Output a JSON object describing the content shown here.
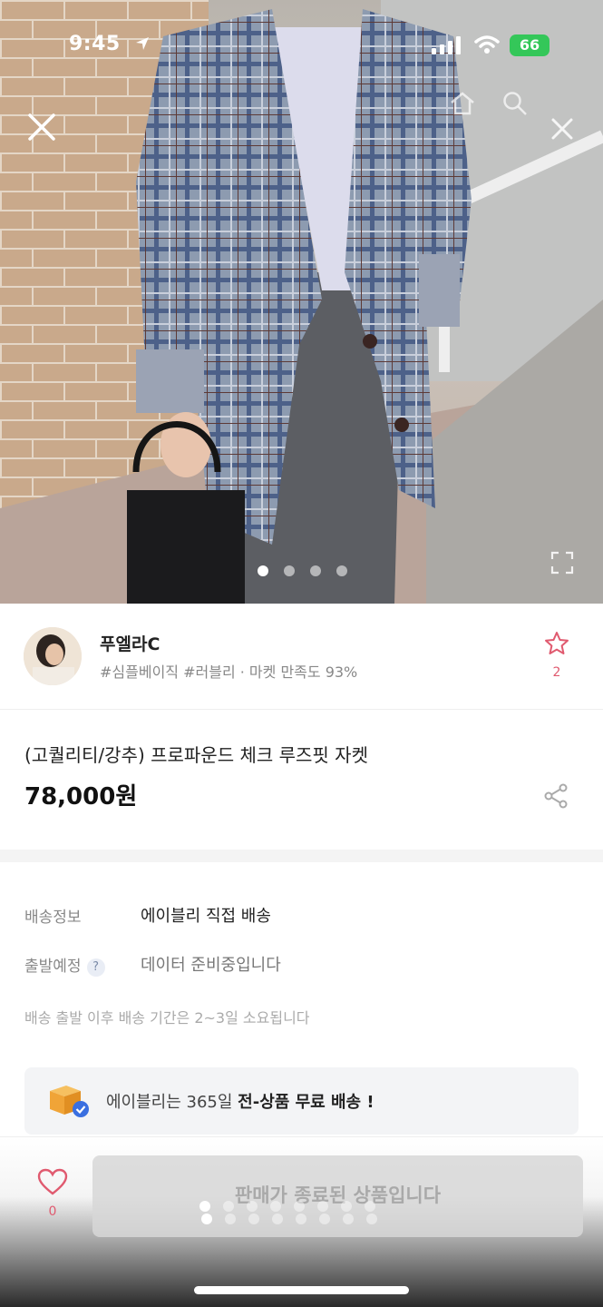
{
  "status_bar": {
    "time": "9:45",
    "battery": "66"
  },
  "hero": {
    "dots_total": 4,
    "dots_active": 0
  },
  "seller": {
    "name": "푸엘라C",
    "tags": "#심플베이직 #러블리 · 마켓 만족도 93%",
    "star_count": "2"
  },
  "product": {
    "title": "(고퀄리티/강추) 프로파운드 체크 루즈핏 자켓",
    "price": "78,000원"
  },
  "shipping": {
    "info_label": "배송정보",
    "info_value": "에이블리 직접 배송",
    "depart_label": "출발예정",
    "depart_help": "?",
    "depart_value": "데이터 준비중입니다",
    "note": "배송 출발 이후 배송 기간은 2~3일 소요됩니다",
    "promo_prefix": "에이블리는 365일 ",
    "promo_bold": "전-상품 무료 배송 !"
  },
  "bottom_bar": {
    "like_count": "0",
    "soldout_label": "판매가 종료된 상품입니다"
  },
  "colors": {
    "accent": "#e05a6f",
    "battery": "#34c759",
    "promo_bg": "#f3f4f6"
  }
}
